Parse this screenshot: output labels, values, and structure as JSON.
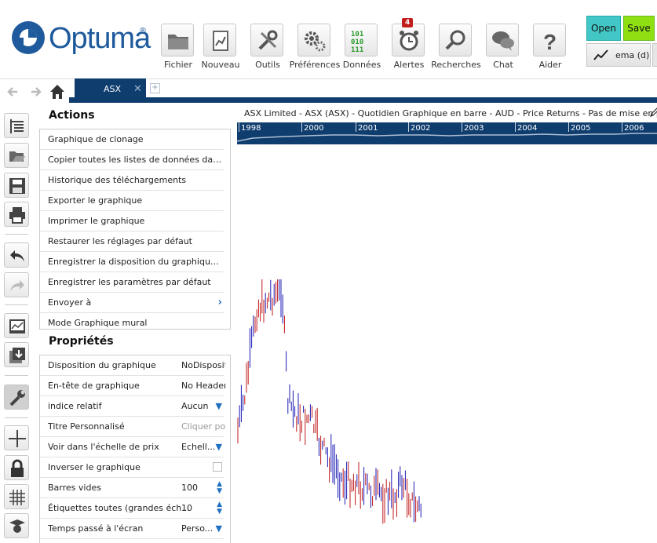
{
  "app": {
    "brand": "Optuma",
    "registered": "®"
  },
  "toolbar": {
    "buttons": [
      {
        "id": "file",
        "label": "Fichier",
        "icon": "folder-icon"
      },
      {
        "id": "new",
        "label": "Nouveau",
        "icon": "new-chart-icon"
      },
      {
        "id": "tools",
        "label": "Outils",
        "icon": "tools-icon"
      },
      {
        "id": "prefs",
        "label": "Préférences",
        "icon": "gears-icon"
      },
      {
        "id": "data",
        "label": "Données",
        "icon": "binary-data-icon"
      },
      {
        "id": "alerts",
        "label": "Alertes",
        "icon": "alarm-clock-icon",
        "badge": "4"
      },
      {
        "id": "search",
        "label": "Recherches",
        "icon": "magnifier-icon"
      },
      {
        "id": "chat",
        "label": "Chat",
        "icon": "chat-bubbles-icon"
      },
      {
        "id": "help",
        "label": "Aider",
        "icon": "question-mark-icon"
      }
    ],
    "open_label": "Open",
    "save_label": "Save",
    "ema_label": "ema (d)"
  },
  "tabs": {
    "active": "ASX",
    "close": "✕",
    "add": "+"
  },
  "actions": {
    "title": "Actions",
    "items": [
      "Graphique de clonage",
      "Copier toutes les listes de données dans ...",
      "Historique des téléchargements",
      "Exporter le graphique",
      "Imprimer le graphique",
      "Restaurer les réglages par défaut",
      "Enregistrer la disposition du graphique p...",
      "Enregistrer les paramètres par défaut",
      "Envoyer à",
      "Mode Graphique mural"
    ],
    "submenu_chevron": "›"
  },
  "properties": {
    "title": "Propriétés",
    "rows": [
      {
        "label": "Disposition du graphique",
        "value": "NoDisposit",
        "control": "text"
      },
      {
        "label": "En-tête de graphique",
        "value": "No Header",
        "control": "text"
      },
      {
        "label": "indice relatif",
        "value": "Aucun",
        "control": "dropdown"
      },
      {
        "label": "Titre Personnalisé",
        "value": "Cliquer po",
        "control": "placeholder"
      },
      {
        "label": "Voir dans l'échelle de prix",
        "value": "Echell...",
        "control": "dropdown"
      },
      {
        "label": "Inverser le graphique",
        "value": "",
        "control": "checkbox",
        "checked": false
      },
      {
        "label": "Barres vides",
        "value": "100",
        "control": "spinner"
      },
      {
        "label": "Étiquettes toutes (grandes éch...",
        "value": "10",
        "control": "spinner"
      },
      {
        "label": "Temps passé à l'écran",
        "value": "Perso...",
        "control": "dropdown"
      }
    ]
  },
  "chart": {
    "title": "ASX Limited - ASX (ASX) - Quotidien Graphique en barre - AUD - Price Returns - Pas de mise en page",
    "timeline_years": [
      "1998",
      "2000",
      "2001",
      "2002",
      "2003",
      "2004",
      "2005",
      "2006"
    ],
    "colors": {
      "up": "#1a1ab4",
      "down": "#c01818",
      "navy": "#0f3d6e"
    }
  }
}
